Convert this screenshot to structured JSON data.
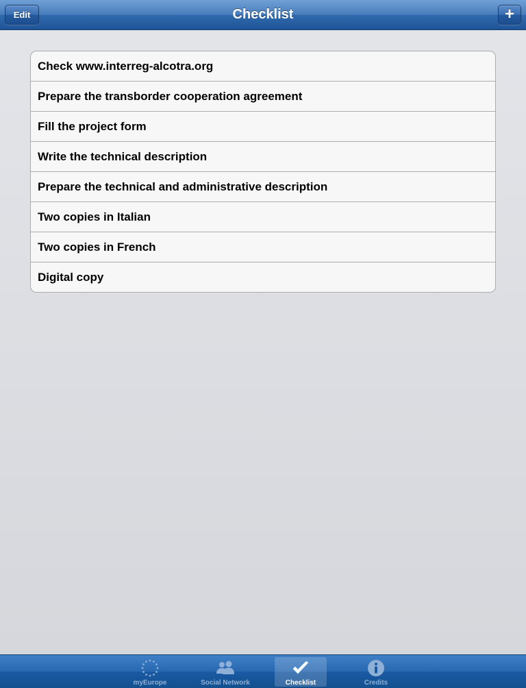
{
  "nav": {
    "title": "Checklist",
    "edit_label": "Edit",
    "add_label": "+"
  },
  "checklist": {
    "items": [
      {
        "label": "Check www.interreg-alcotra.org"
      },
      {
        "label": "Prepare the transborder cooperation agreement"
      },
      {
        "label": "Fill the project form"
      },
      {
        "label": "Write the technical description"
      },
      {
        "label": "Prepare the technical and administrative description"
      },
      {
        "label": "Two copies in Italian"
      },
      {
        "label": "Two copies in French"
      },
      {
        "label": "Digital copy"
      }
    ]
  },
  "tabbar": {
    "tabs": [
      {
        "label": "myEurope",
        "icon": "eu-stars-icon",
        "selected": false
      },
      {
        "label": "Social Network",
        "icon": "people-icon",
        "selected": false
      },
      {
        "label": "Checklist",
        "icon": "checkmark-icon",
        "selected": true
      },
      {
        "label": "Credits",
        "icon": "info-icon",
        "selected": false
      }
    ]
  },
  "colors": {
    "navbar": "#2f69ad",
    "tabbar": "#1a5aa3",
    "background": "#d8dade",
    "list_background": "#f7f7f7",
    "tab_inactive_label": "#8fb0d6",
    "tab_active_label": "#ffffff"
  }
}
